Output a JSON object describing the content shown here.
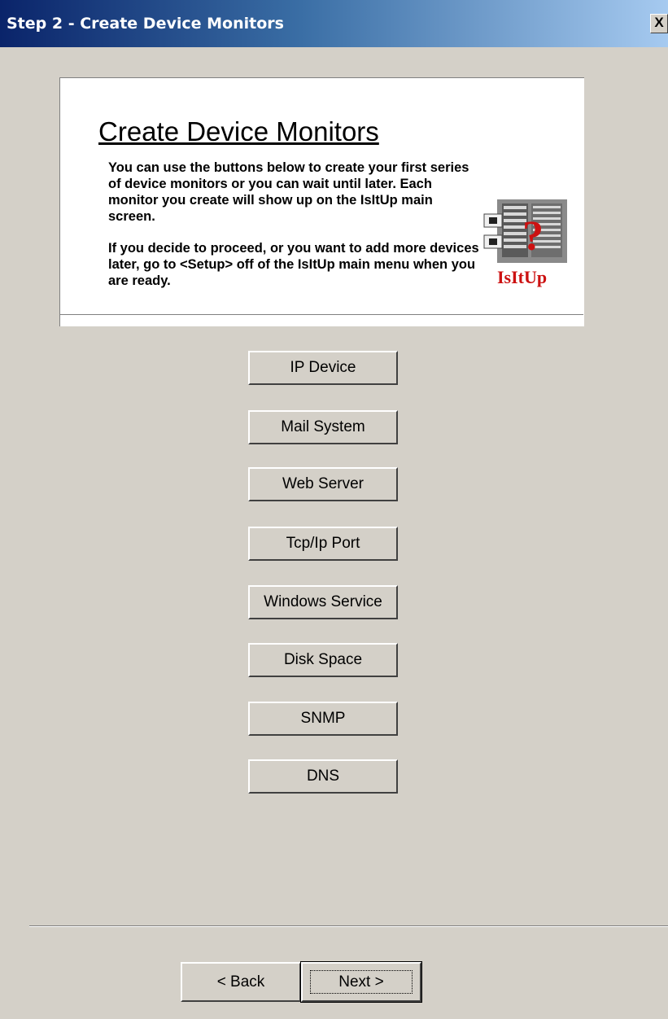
{
  "window": {
    "title": "Step 2 - Create Device Monitors",
    "close_label": "X"
  },
  "header": {
    "title": "Create Device Monitors",
    "paragraph1": "You can use the buttons below to create your first series of device monitors or you can wait until later. Each monitor you create will show up on the IsItUp main screen.",
    "paragraph2": "If you decide to proceed, or you want to add more devices later, go to <Setup> off of the IsItUp main menu when you are ready.",
    "logo_text": "IsItUp",
    "logo_icon": "server-rack-question-icon"
  },
  "monitor_buttons": [
    "IP Device",
    "Mail System",
    "Web Server",
    "Tcp/Ip Port",
    "Windows Service",
    "Disk Space",
    "SNMP",
    "DNS"
  ],
  "nav": {
    "back_label": "< Back",
    "next_label": "Next >"
  },
  "colors": {
    "face": "#d4d0c8",
    "title_start": "#0a246a",
    "title_end": "#a6caf0",
    "logo_red": "#cc1111"
  }
}
